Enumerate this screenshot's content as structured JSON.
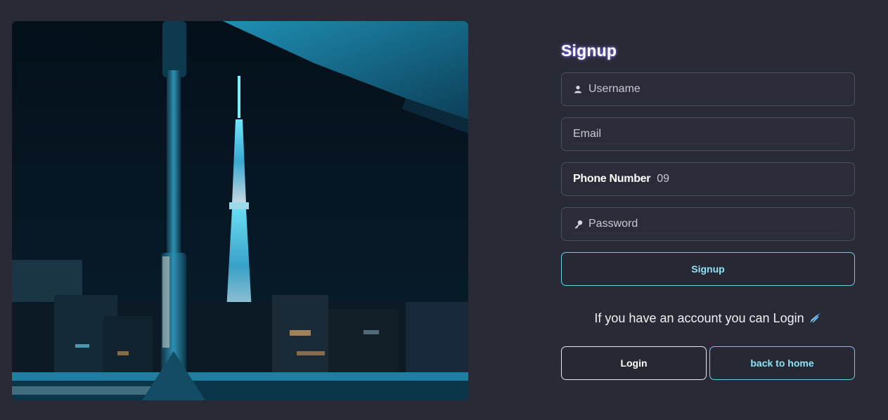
{
  "form": {
    "title": "Signup",
    "username_placeholder": "Username",
    "email_placeholder": "Email",
    "phone_label": "Phone Number",
    "phone_prefix": "09",
    "password_placeholder": "Password",
    "signup_button": "Signup",
    "login_hint": "If you have an account you can Login",
    "login_button": "Login",
    "home_button": "back to home"
  },
  "icons": {
    "username": "user-icon",
    "password": "key-icon",
    "hint": "paper-plane-icon"
  },
  "colors": {
    "background": "#282a36",
    "accent_cyan": "#6ad0e8",
    "title_glow": "#8c78ff",
    "field_border": "#4c4f5e"
  }
}
